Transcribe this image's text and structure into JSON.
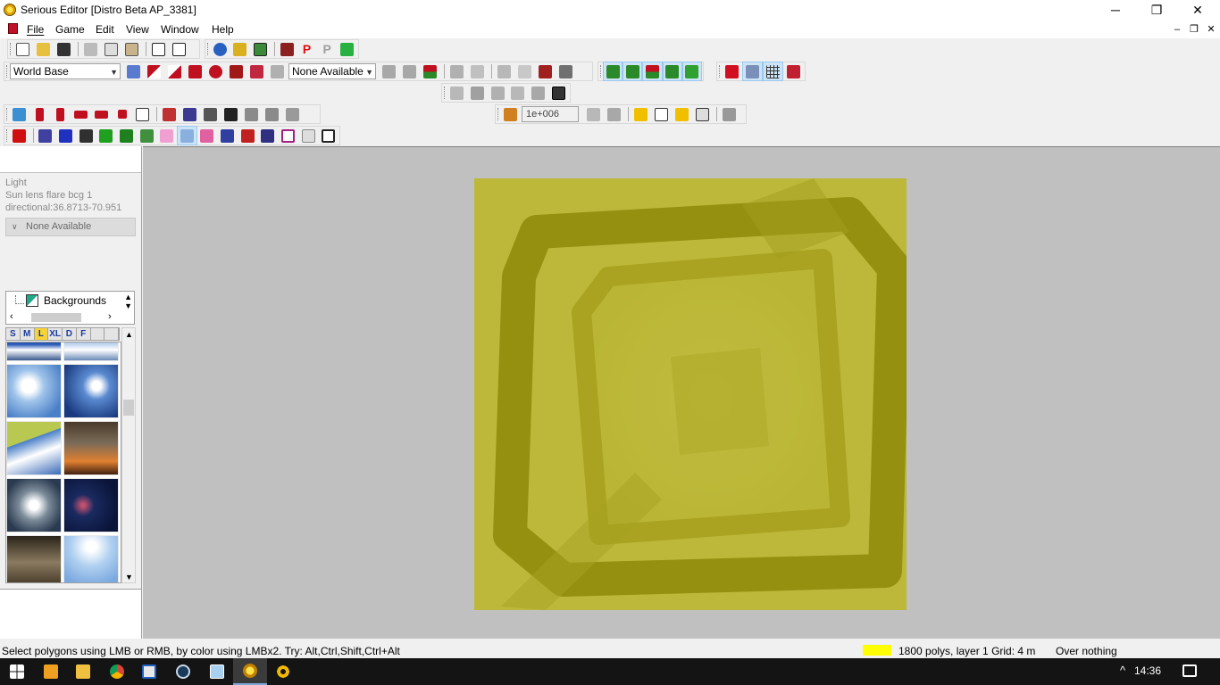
{
  "window": {
    "title": "Serious Editor [Distro Beta AP_3381]",
    "minimize": "─",
    "maximize": "❐",
    "close": "✕"
  },
  "menu": {
    "items": [
      "File",
      "Game",
      "Edit",
      "View",
      "Window",
      "Help"
    ],
    "mdi_min": "–",
    "mdi_restore": "❐",
    "mdi_close": "✕"
  },
  "toolbar": {
    "world_combo": "World Base",
    "none_combo": "None Available",
    "p_red": "P",
    "p_grey": "P",
    "grid_size": "1e+006"
  },
  "properties": {
    "class": "Light",
    "name": "Sun lens flare bcg 1",
    "info": "directional:36.8713-70.951",
    "combo": "None Available"
  },
  "browser": {
    "tree_label": "Backgrounds",
    "sizes": [
      "S",
      "M",
      "L",
      "XL",
      "D",
      "F",
      "",
      ""
    ],
    "active_size": "L"
  },
  "status": {
    "message": "Select polygons using LMB or RMB, by color using LMBx2. Try: Alt,Ctrl,Shift,Ctrl+Alt",
    "color": "#ffff00",
    "polys": "1800 polys, layer 1 Grid: 4 m",
    "over": "Over nothing"
  },
  "taskbar": {
    "time": "14:36",
    "tray_arrow": "^"
  },
  "colors": {
    "terrain_light": "#c8c446",
    "terrain_dark": "#8a8400",
    "viewport_bg": "#c0c0c0"
  }
}
